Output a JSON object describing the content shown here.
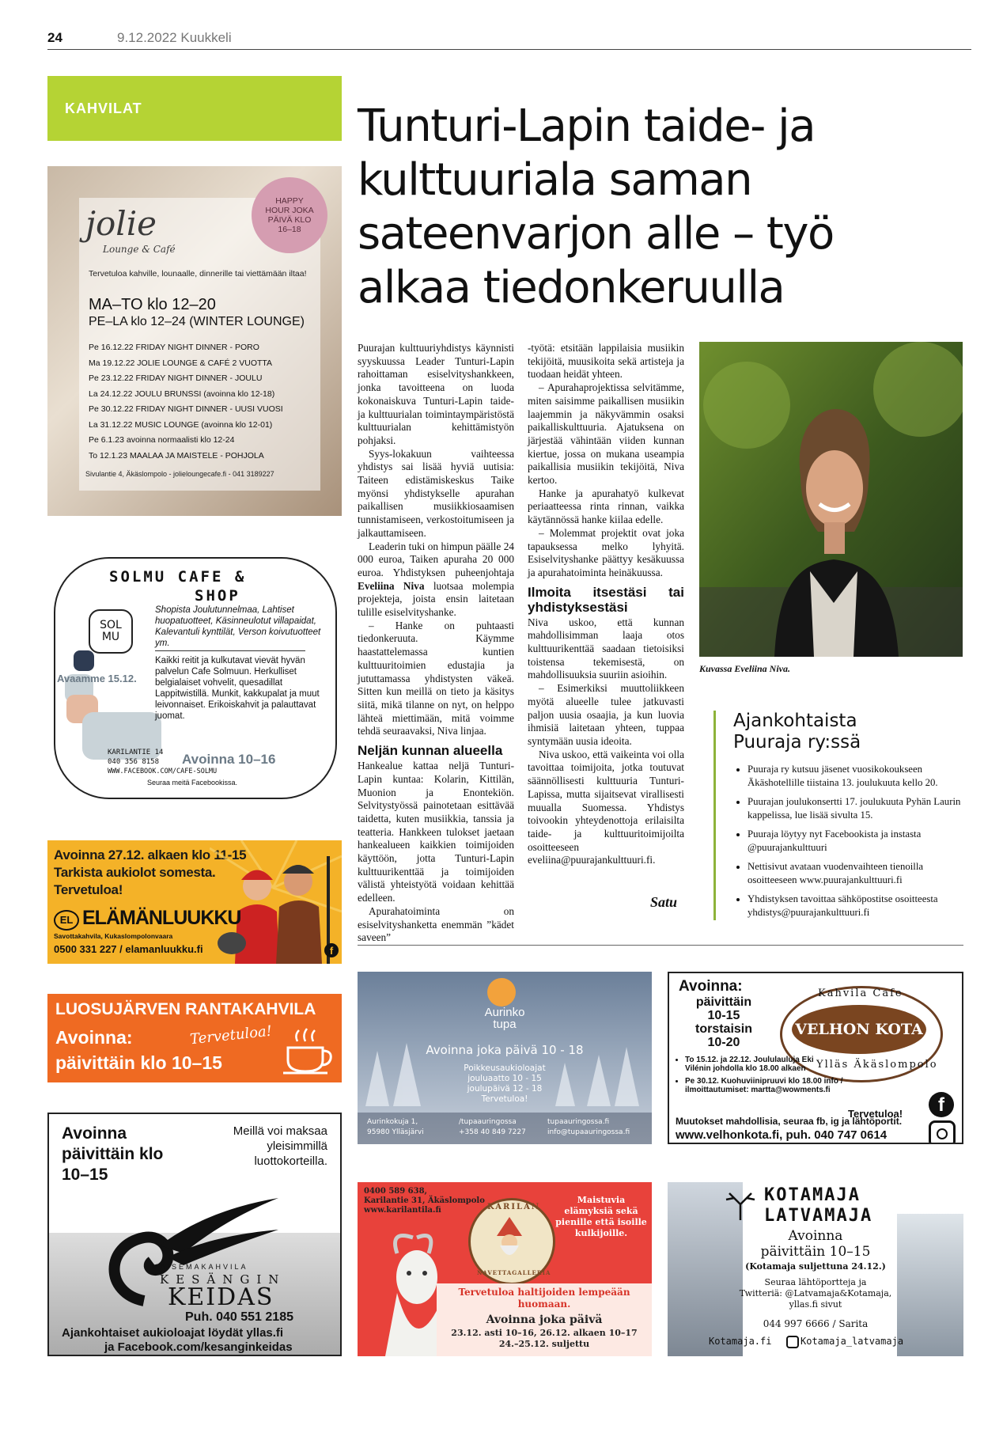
{
  "header": {
    "page_number": "24",
    "date_publication": "9.12.2022 Kuukkeli"
  },
  "section": {
    "label": "KAHVILAT"
  },
  "article": {
    "headline": "Tunturi-Lapin taide- ja kulttuuriala saman sateenvarjon alle – työ alkaa tiedonkeruulla",
    "col1": {
      "p1": "Puurajan kulttuuriyhdistys käynnisti syyskuussa Leader Tunturi-Lapin rahoittaman esiselvityshankkeen, jonka tavoitteena on luoda kokonaiskuva Tunturi-Lapin taide- ja kulttuurialan toimintaympäristöstä kulttuurialan kehittämistyön pohjaksi.",
      "p2": "Syys-lokakuun vaihteessa yhdistys sai lisää hyviä uutisia: Taiteen edistämiskeskus Taike myönsi yhdistykselle apurahan paikallisen musiikkiosaamisen tunnistamiseen, verkostoitumiseen ja jalkauttamiseen.",
      "p3a": "Leaderin tuki on himpun päälle 24 000 euroa, Taiken apuraha 20 000 euroa. Yhdistyksen puheenjohtaja ",
      "p3name": "Eveliina Niva",
      "p3b": " luotsaa molempia projekteja, joista ensin laitetaan tulille esiselvityshanke.",
      "p4": "– Hanke on puhtaasti tiedonkeruuta. Käymme haastattelemassa kuntien kulttuuritoimien edustajia ja jututtamassa yhdistysten väkeä. Sitten kun meillä on tieto ja käsitys siitä, mikä tilanne on nyt, on helppo lähteä miettimään, mitä voimme tehdä seuraavaksi, Niva linjaa.",
      "h_kunnat": "Neljän kunnan alueella",
      "p5": "Hankealue kattaa neljä Tunturi-Lapin kuntaa: Kolarin, Kittilän, Muonion ja Enontekiön. Selvitystyössä painotetaan esittävää taidetta, kuten musiikkia, tanssia ja teatteria. Hankkeen tulokset jaetaan hankealueen kaikkien toimijoiden käyttöön, jotta Tunturi-Lapin kulttuurikenttää ja toimijoiden välistä yhteistyötä voidaan kehittää edelleen.",
      "p6": "Apurahatoiminta on esiselvityshanketta enemmän ”kädet saveen”"
    },
    "col2": {
      "p1": "-työtä: etsitään lappilaisia musiikin tekijöitä, muusikoita sekä artisteja ja tuodaan heidät yhteen.",
      "p2": "– Apurahaprojektissa selvitämme, miten saisimme paikallisen musiikin laajemmin ja näkyvämmin osaksi paikalliskulttuuria. Ajatuksena on järjestää vähintään viiden kunnan kiertue, jossa on mukana useampia paikallisia musiikin tekijöitä, Niva kertoo.",
      "p3": "Hanke ja apurahatyö kulkevat periaatteessa rinta rinnan, vaikka käytännössä hanke kiilaa edelle.",
      "p4": "– Molemmat projektit ovat joka tapauksessa melko lyhyitä. Esiselvityshanke päättyy kesäkuussa ja apurahatoiminta heinäkuussa.",
      "h_ilmoita": "Ilmoita itsestäsi tai yhdistyksestäsi",
      "p5": "Niva uskoo, että kunnan mahdollisimman laaja otos kulttuurikenttää saadaan tietoisiksi toistensa tekemisestä, on mahdollisuuksia suuriin asioihin.",
      "p6": "– Esimerkiksi muuttoliikkeen myötä alueelle tulee jatkuvasti paljon uusia osaajia, ja kun luovia ihmisiä laitetaan yhteen, tuppaa syntymään uusia ideoita.",
      "p7": "Niva uskoo, että vaikeinta voi olla tavoittaa toimijoita, jotka toutuvat säännöllisesti kulttuuria Tunturi-Lapissa, mutta sijaitsevat virallisesti muualla Suomessa. Yhdistys toivookin yhteydenottoja erilaisilta taide- ja kulttuuritoimijoilta osoitteeseen eveliina@puurajankulttuuri.fi."
    },
    "photo_caption": "Kuvassa Eveliina Niva.",
    "signature": "Satu"
  },
  "sidebar": {
    "title_line1": "Ajankohtaista",
    "title_line2": "Puuraja ry:ssä",
    "items": [
      "Puuraja ry kutsuu jäsenet vuosikokoukseen Äkäshotellille tiistaina 13. joulukuuta kello 20.",
      "Puurajan joulukonsertti 17. joulukuuta Pyhän Laurin kappelissa, lue lisää sivulta 15.",
      "Puuraja löytyy nyt Facebookista ja instasta @puurajankulttuuri",
      "Nettisivut avataan vuodenvaihteen tienoilla osoitteeseen www.puurajankulttuuri.fi",
      "Yhdistyksen tavoittaa sähköpostitse osoitteesta yhdistys@puurajankulttuuri.fi"
    ]
  },
  "ads": {
    "jolie": {
      "happy_hour": "HAPPY HOUR JOKA PÄIVÄ KLO 16–18",
      "logo": "jolie",
      "logo_sub": "Lounge & Café",
      "intro": "Tervetuloa kahville, lounaalle, dinnerille tai viettämään iltaa!",
      "hours1": "MA–TO klo 12–20",
      "hours2": "PE–LA klo 12–24 (WINTER LOUNGE)",
      "events": [
        "Pe 16.12.22 FRIDAY NIGHT DINNER - PORO",
        "Ma 19.12.22 JOLIE LOUNGE & CAFÉ 2 VUOTTA",
        "Pe 23.12.22 FRIDAY NIGHT DINNER - JOULU",
        "La 24.12.22 JOULU BRUNSSI (avoinna klo 12-18)",
        "Pe 30.12.22 FRIDAY NIGHT DINNER - UUSI VUOSI",
        "La 31.12.22 MUSIC LOUNGE (avoinna klo 12-01)",
        "Pe 6.1.23 avoinna normaalisti klo 12-24",
        "To 12.1.23 MAALAA JA MAISTELE - POHJOLA"
      ],
      "footer": "Sivulantie 4, Äkäslompolo - jolieloungecafe.fi - 041 3189227"
    },
    "solmu": {
      "title1": "SOLMU CAFE &",
      "title2": "SHOP",
      "logo": "SOL MU",
      "desc1": "Shopista Joulutunnelmaa, Lahtiset huopatuotteet, Käsinneulotut villapaidat, Kalevantuli kynttilät, Verson koivutuotteet ym.",
      "desc2": "Kaikki reitit ja kulkutavat vievät hyvän palvelun Cafe Solmuun. Herkulliset belgialaiset vohvelit, quesadillat Lappitwistillä. Munkit, kakkupalat ja muut leivonnaiset. Erikoiskahvit ja palauttavat juomat.",
      "opens": "Avaamme 15.12.",
      "address1": "KARILANTIE 14",
      "address2": "040 356 8158",
      "web": "WWW.FACEBOOK.COM/CAFE-SOLMU",
      "hours": "Avoinna 10–16",
      "follow": "Seuraa meitä Facebookissa."
    },
    "elamanluukku": {
      "line1": "Avoinna 27.12. alkaen klo 11-15",
      "line2": "Tarkista aukiolot somesta.",
      "line3": "Tervetuloa!",
      "logo": "ELÄMÄNLUUKKU",
      "logo_badge": "EL",
      "sub": "Savottakahvila, Kukaslompolonvaara",
      "contact": "0500 331 227 / elamanluukku.fi"
    },
    "luosujarvi": {
      "title": "LUOSUJÄRVEN RANTAKAHVILA",
      "open": "Avoinna:",
      "welcome": "Tervetuloa!",
      "hours": "päivittäin klo 10–15"
    },
    "kesanki": {
      "open": "Avoinna päivittäin klo 10–15",
      "cards": "Meillä voi maksaa yleisimmillä luottokorteilla.",
      "brand_top": "MAISEMAKAHVILA",
      "brand_mid": "KESÄNGIN",
      "brand_name": "KEIDAS",
      "phone": "Puh. 040 551 2185",
      "info1": "Ajankohtaiset aukioloajat löydät yllas.fi",
      "info2": "ja Facebook.com/kesanginkeidas"
    },
    "aurinkotupa": {
      "logo1": "Aurinko",
      "logo2": "tupa",
      "open": "Avoinna joka päivä 10 - 18",
      "exc": "Poikkeusaukioloajat",
      "exc1": "jouluaatto 10 - 15",
      "exc2": "joulupäivä 12 - 18",
      "welcome": "Tervetuloa!",
      "addr1": "Aurinkokuja 1,",
      "addr2": "95980 Ylläsjärvi",
      "social": "/tupaauringossa",
      "phone": "+358 40 849 7227",
      "web": "tupaauringossa.fi",
      "email": "info@tupaauringossa.fi"
    },
    "velhonkota": {
      "open": "Avoinna:",
      "daily": "päivittäin",
      "hours1": "10-15",
      "thu": "torstaisin",
      "hours2": "10-20",
      "arc_top": "Kahvila Cafe",
      "brand": "VELHON KOTA",
      "arc_bottom": "Ylläs Äkäslompolo",
      "ev1": "To 15.12. ja 22.12. Joululauluja Eki Vilénin johdolla klo 18.00 alkaen",
      "ev2": "Pe 30.12. Kuohuviinipruuvi klo 18.00 info / ilmoittautumiset: martta@wowments.fi",
      "welcome": "Tervetuloa!",
      "changes": "Muutokset mahdollisia, seuraa fb, ig ja lähtöportit.",
      "web": "www.velhonkota.fi, puh. 040 747 0614"
    },
    "karilan": {
      "contact1": "0400 589 638,",
      "contact2": "Karilantie 31, Äkäslompolo",
      "contact3": "www.karilantila.fi",
      "taste": "Maistuvia elämyksiä sekä pienille että isoille kulkijoille.",
      "seal_top": "KARILAN",
      "seal_bottom": "NAVETTAGALLERIA",
      "welcome": "Tervetuloa haltijoiden lempeään huomaan.",
      "open": "Avoinna joka päivä",
      "hours1": "23.12. asti 10–16, 26.12. alkaen 10–17",
      "hours2": "24.–25.12. suljettu"
    },
    "kotamaja": {
      "title1": "KOTAMAJA",
      "title2": "LATVAMAJA",
      "open": "Avoinna",
      "hours": "päivittäin 10–15",
      "closed": "(Kotamaja suljettuna 24.12.)",
      "follow1": "Seuraa lähtöportteja ja",
      "follow2": "Twitteriä: @Latvamaja&Kotamaja,",
      "follow3": "yllas.fi sivut",
      "phone": "044 997 6666 / Sarita",
      "web": "Kotamaja.fi",
      "insta": "Kotamaja_latvamaja"
    }
  }
}
